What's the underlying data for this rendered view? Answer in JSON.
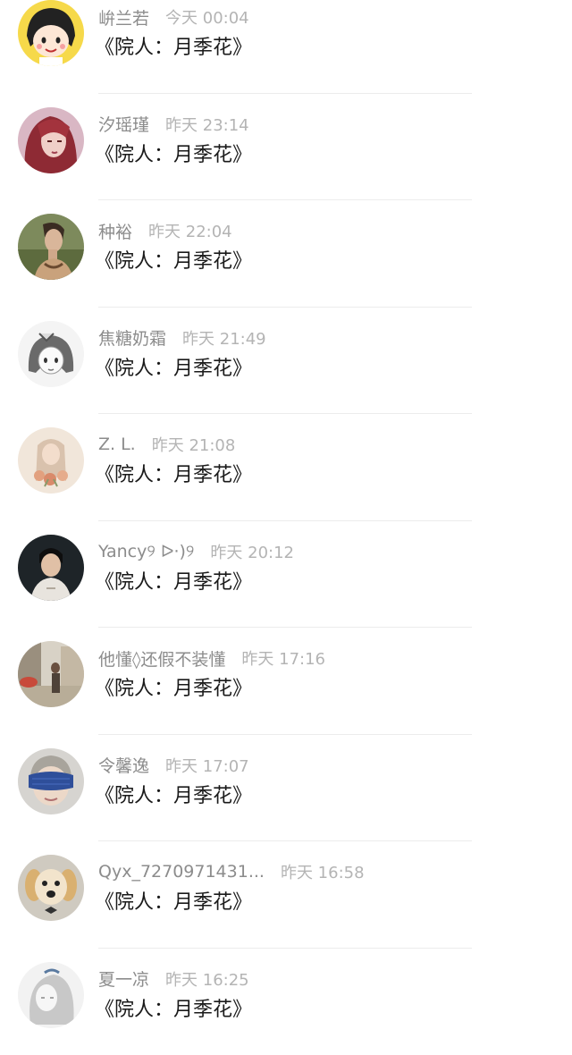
{
  "comments": [
    {
      "user": "峅兰若",
      "time": "今天 00:04",
      "text": "《院人：月季花》",
      "avatar_icon": "cartoon-girl-avatar-icon"
    },
    {
      "user": "汐瑶瑾",
      "time": "昨天 23:14",
      "text": "《院人：月季花》",
      "avatar_icon": "red-hair-portrait-avatar-icon"
    },
    {
      "user": "种裕",
      "time": "昨天 22:04",
      "text": "《院人：月季花》",
      "avatar_icon": "woman-portrait-avatar-icon"
    },
    {
      "user": "焦糖奶霜",
      "time": "昨天 21:49",
      "text": "《院人：月季花》",
      "avatar_icon": "anime-girl-avatar-icon"
    },
    {
      "user": "Z. L.",
      "time": "昨天 21:08",
      "text": "《院人：月季花》",
      "avatar_icon": "flower-illustration-avatar-icon"
    },
    {
      "user": "Yancy୨ ᐅ·)୨",
      "time": "昨天 20:12",
      "text": "《院人：月季花》",
      "avatar_icon": "man-dark-portrait-avatar-icon"
    },
    {
      "user": "他懂◊还假不装懂",
      "time": "昨天 17:16",
      "text": "《院人：月季花》",
      "avatar_icon": "street-photo-avatar-icon"
    },
    {
      "user": "令馨逸",
      "time": "昨天 17:07",
      "text": "《院人：月季花》",
      "avatar_icon": "eye-mask-avatar-icon"
    },
    {
      "user": "Qyx_7270971431...",
      "time": "昨天 16:58",
      "text": "《院人：月季花》",
      "avatar_icon": "puppy-avatar-icon"
    },
    {
      "user": "夏一凉",
      "time": "昨天 16:25",
      "text": "《院人：月季花》",
      "avatar_icon": "sketch-girl-avatar-icon"
    }
  ],
  "colors": {
    "name": "#8c8c8c",
    "time": "#b4b4b4",
    "message": "#1a1a1a",
    "divider": "#ececec"
  }
}
